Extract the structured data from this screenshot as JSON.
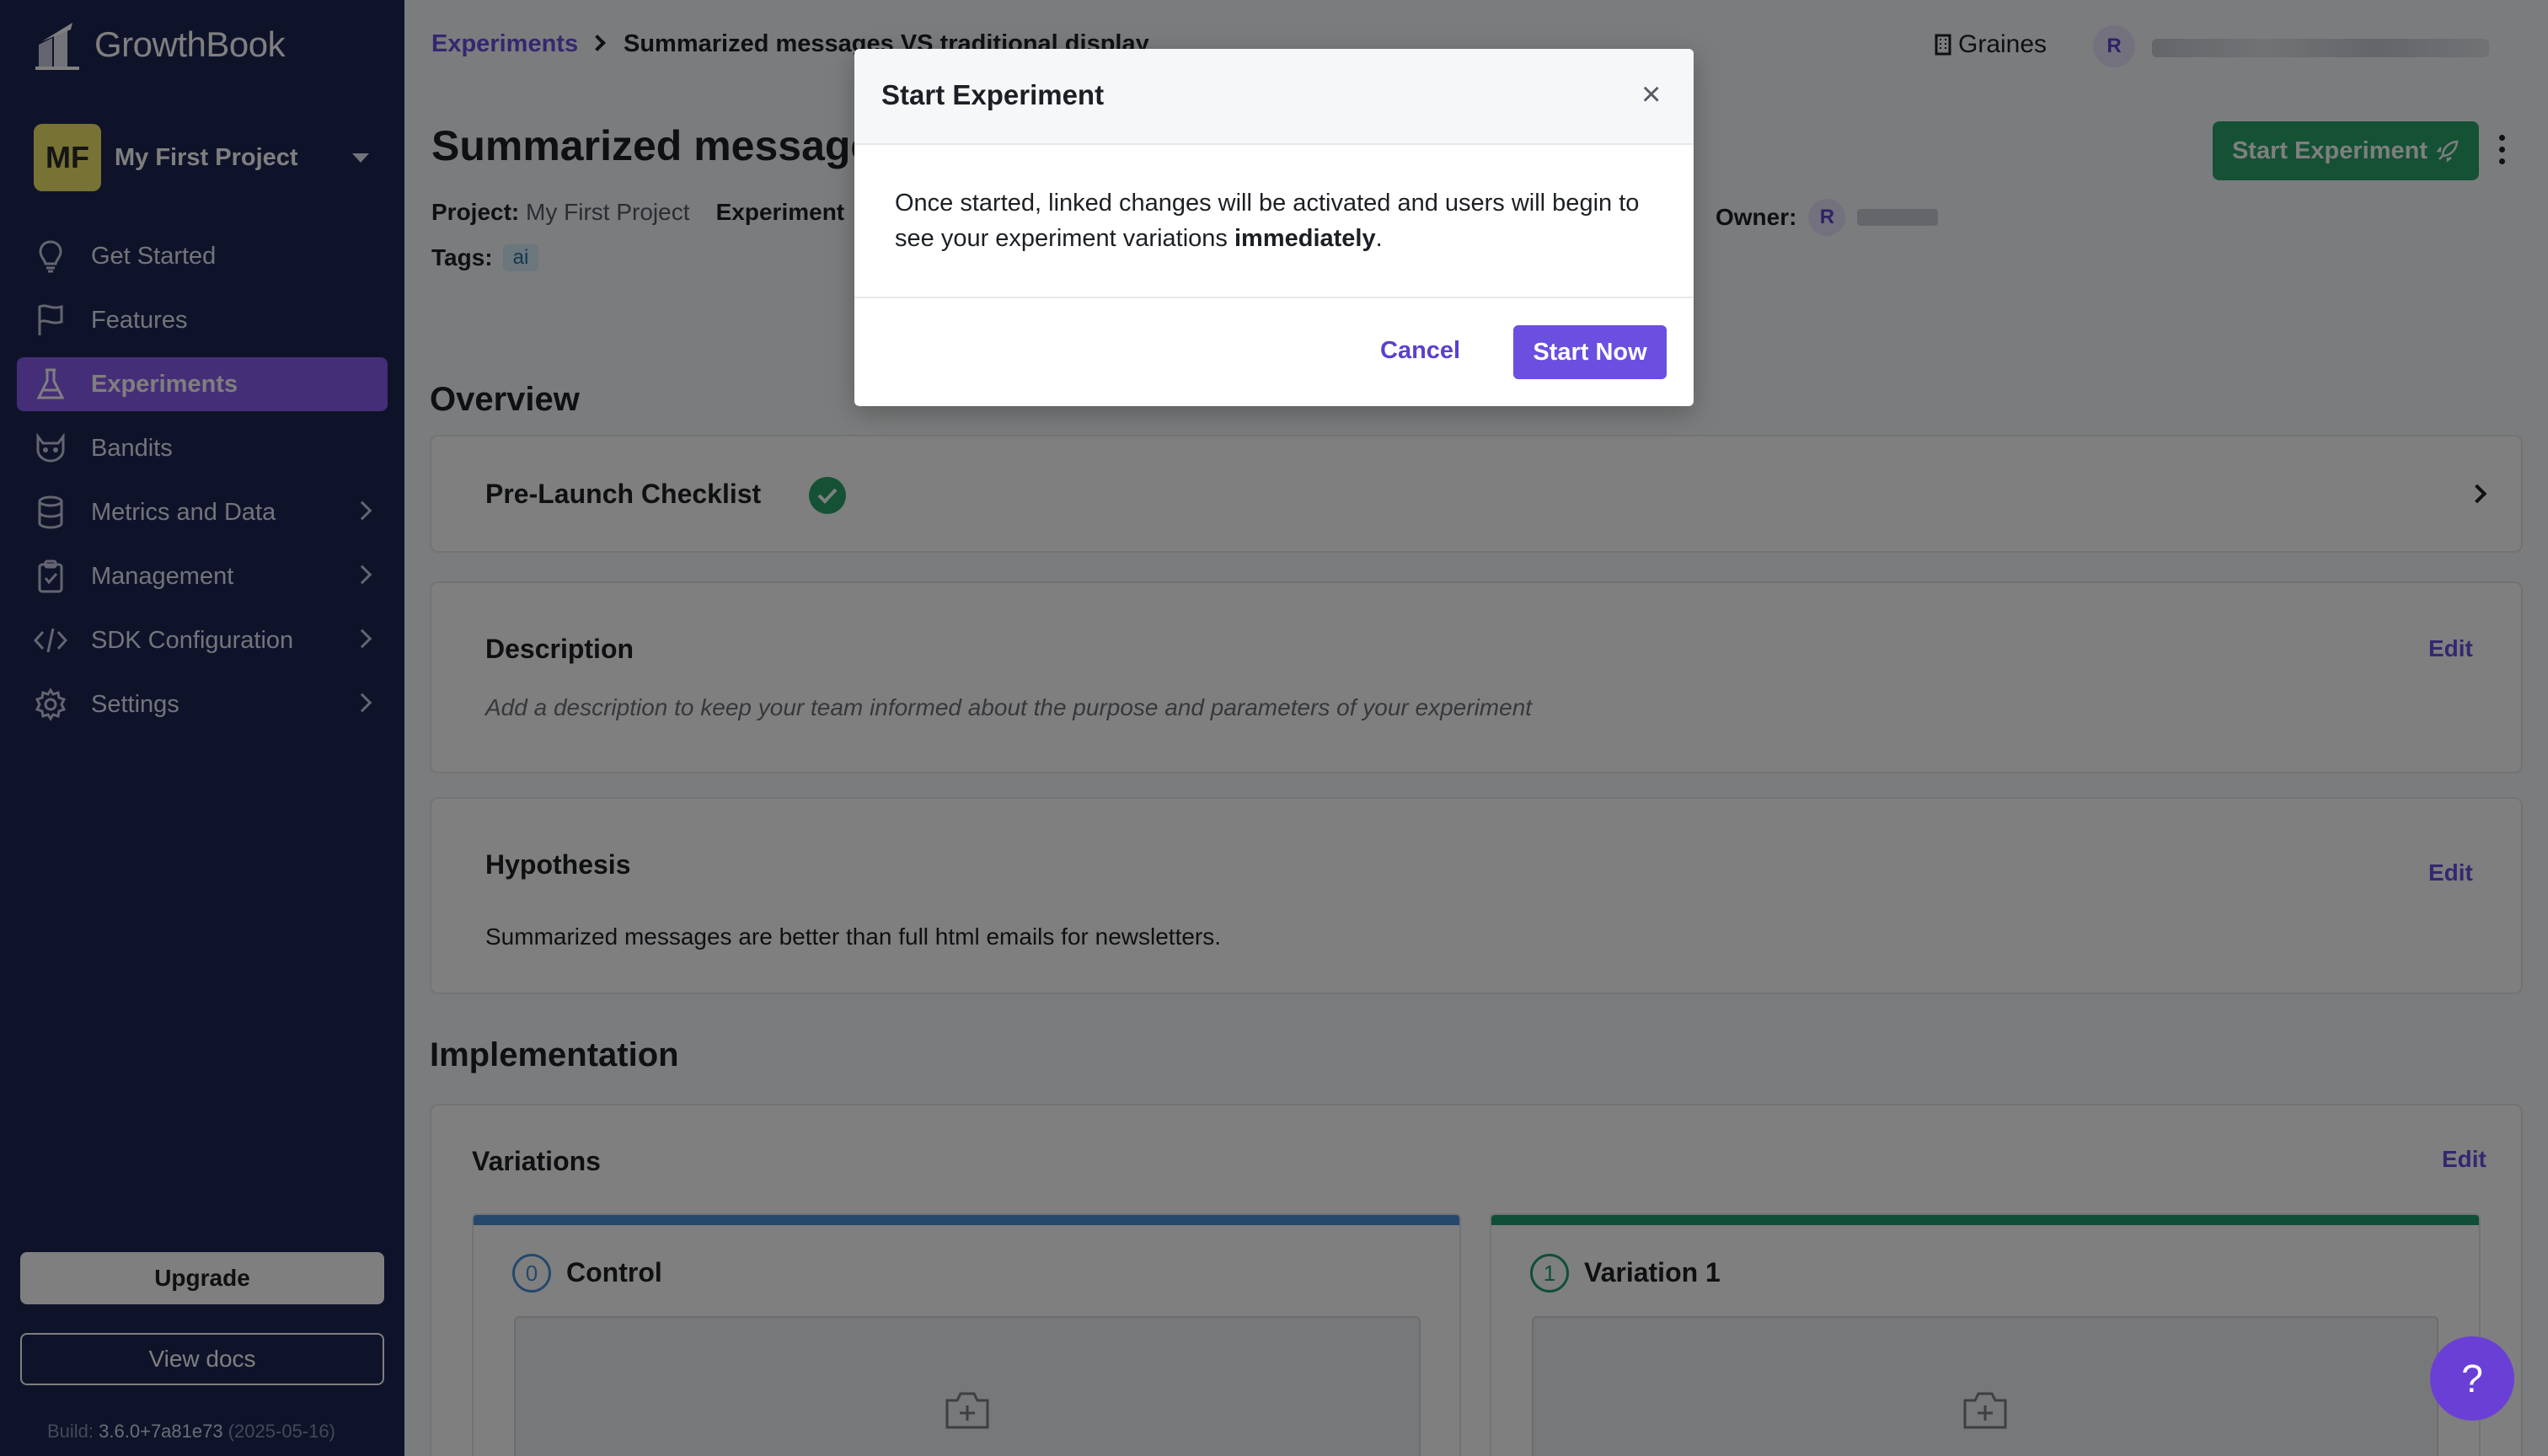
{
  "app": {
    "name": "GrowthBook"
  },
  "project": {
    "initials": "MF",
    "name": "My First Project"
  },
  "sidebar": {
    "items": [
      {
        "label": "Get Started"
      },
      {
        "label": "Features"
      },
      {
        "label": "Experiments"
      },
      {
        "label": "Bandits"
      },
      {
        "label": "Metrics and Data"
      },
      {
        "label": "Management"
      },
      {
        "label": "SDK Configuration"
      },
      {
        "label": "Settings"
      }
    ],
    "upgrade_label": "Upgrade",
    "docs_label": "View docs",
    "build_label": "Build:",
    "build_version": "3.6.0+7a81e73",
    "build_date": "(2025-05-16)"
  },
  "topbar": {
    "breadcrumb_link": "Experiments",
    "breadcrumb_current": "Summarized messages VS traditional display",
    "org": "Graines",
    "user_initial": "R"
  },
  "experiment": {
    "title": "Summarized messages VS traditional display",
    "start_button": "Start Experiment",
    "project_label": "Project:",
    "project_value": "My First Project",
    "experiment_label": "Experiment",
    "owner_label": "Owner:",
    "owner_initial": "R",
    "tags_label": "Tags:",
    "tags": [
      "ai"
    ]
  },
  "overview": {
    "heading": "Overview",
    "checklist_title": "Pre-Launch Checklist",
    "description_title": "Description",
    "description_edit": "Edit",
    "description_placeholder": "Add a description to keep your team informed about the purpose and parameters of your experiment",
    "hypothesis_title": "Hypothesis",
    "hypothesis_edit": "Edit",
    "hypothesis_text": "Summarized messages are better than full html emails for newsletters."
  },
  "implementation": {
    "heading": "Implementation",
    "variations_title": "Variations",
    "variations_edit": "Edit",
    "variations": [
      {
        "index": "0",
        "name": "Control",
        "color": "#4a90d9"
      },
      {
        "index": "1",
        "name": "Variation 1",
        "color": "#1e9f6e"
      }
    ]
  },
  "help_label": "?",
  "modal": {
    "title": "Start Experiment",
    "close": "×",
    "body_prefix": "Once started, linked changes will be activated and users will begin to see your experiment variations ",
    "body_emphasis": "immediately",
    "body_suffix": ".",
    "cancel_label": "Cancel",
    "confirm_label": "Start Now"
  },
  "colors": {
    "sidebar_bg": "#1e2654",
    "accent": "#6a4fe0",
    "success": "#2aa36b",
    "active_nav": "#8a5cf0"
  }
}
